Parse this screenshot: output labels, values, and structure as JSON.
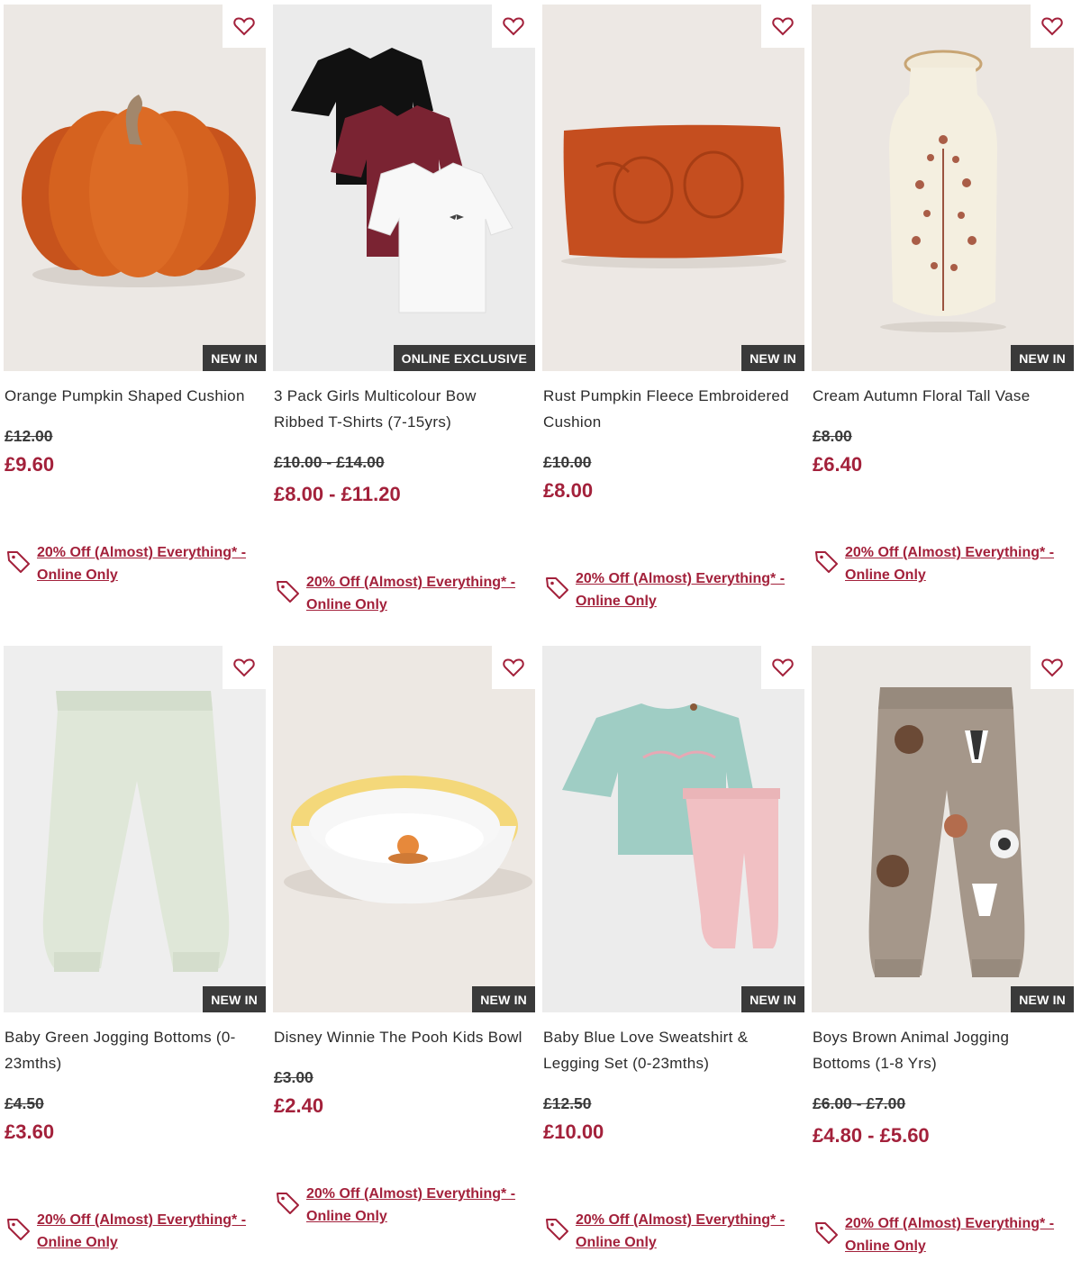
{
  "colors": {
    "price_accent": "#a3213b",
    "badge_bg": "#3a3a3a",
    "image_bg": "#ede9e5"
  },
  "products": [
    {
      "name": "Orange Pumpkin Shaped Cushion",
      "badge": "NEW IN",
      "was_price": "£12.00",
      "now_price": "£9.60",
      "promo": "20% Off (Almost) Everything* - Online Only",
      "wishlist_icon": "heart-outline-icon",
      "image": "orange-pumpkin-cushion"
    },
    {
      "name": "3 Pack Girls Multicolour Bow Ribbed T-Shirts (7-15yrs)",
      "badge": "ONLINE EXCLUSIVE",
      "was_price": "£10.00 - £14.00",
      "now_price": "£8.00 - £11.20",
      "promo": "20% Off (Almost) Everything* - Online Only",
      "wishlist_icon": "heart-outline-icon",
      "image": "three-tshirts"
    },
    {
      "name": "Rust Pumpkin Fleece Embroidered Cushion",
      "badge": "NEW IN",
      "was_price": "£10.00",
      "now_price": "£8.00",
      "promo": "20% Off (Almost) Everything* - Online Only",
      "wishlist_icon": "heart-outline-icon",
      "image": "rust-cushion"
    },
    {
      "name": "Cream Autumn Floral Tall Vase",
      "badge": "NEW IN",
      "was_price": "£8.00",
      "now_price": "£6.40",
      "promo": "20% Off (Almost) Everything* - Online Only",
      "wishlist_icon": "heart-outline-icon",
      "image": "floral-vase"
    },
    {
      "name": "Baby Green Jogging Bottoms (0-23mths)",
      "badge": "NEW IN",
      "was_price": "£4.50",
      "now_price": "£3.60",
      "promo": "20% Off (Almost) Everything* - Online Only",
      "wishlist_icon": "heart-outline-icon",
      "image": "green-joggers"
    },
    {
      "name": "Disney Winnie The Pooh Kids Bowl",
      "badge": "NEW IN",
      "was_price": "£3.00",
      "now_price": "£2.40",
      "promo": "20% Off (Almost) Everything* - Online Only",
      "wishlist_icon": "heart-outline-icon",
      "image": "pooh-bowl"
    },
    {
      "name": "Baby Blue Love Sweatshirt & Legging Set (0-23mths)",
      "badge": "NEW IN",
      "was_price": "£12.50",
      "now_price": "£10.00",
      "promo": "20% Off (Almost) Everything* - Online Only",
      "wishlist_icon": "heart-outline-icon",
      "image": "sweatshirt-legging-set"
    },
    {
      "name": "Boys Brown Animal Jogging Bottoms (1-8 Yrs)",
      "badge": "NEW IN",
      "was_price": "£6.00 - £7.00",
      "now_price": "£4.80 - £5.60",
      "promo": "20% Off (Almost) Everything* - Online Only",
      "wishlist_icon": "heart-outline-icon",
      "image": "animal-joggers"
    }
  ]
}
